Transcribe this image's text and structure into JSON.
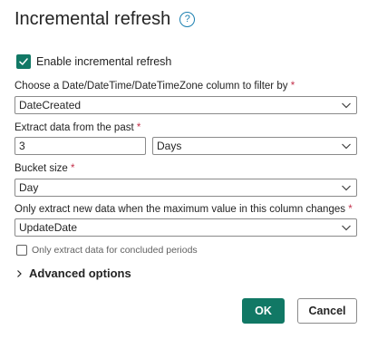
{
  "dialog": {
    "title": "Incremental refresh",
    "help_icon": "?",
    "enable": {
      "label": "Enable incremental refresh",
      "checked": true
    },
    "column": {
      "label": "Choose a Date/DateTime/DateTimeZone column to filter by",
      "required_mark": "*",
      "value": "DateCreated"
    },
    "extract": {
      "label": "Extract data from the past",
      "required_mark": "*",
      "number_value": "3",
      "unit_value": "Days"
    },
    "bucket": {
      "label": "Bucket size",
      "required_mark": "*",
      "value": "Day"
    },
    "detect": {
      "label": "Only extract new data when the maximum value in this column changes",
      "required_mark": "*",
      "value": "UpdateDate"
    },
    "concluded": {
      "label": "Only extract data for concluded periods",
      "checked": false
    },
    "advanced": {
      "label": "Advanced options"
    },
    "buttons": {
      "ok": "OK",
      "cancel": "Cancel"
    },
    "colors": {
      "accent": "#117865",
      "required": "#c4314b",
      "help": "#1a7fb0"
    },
    "icons": {
      "help": "question-circle-icon",
      "check": "checkmark-icon",
      "dropdown": "chevron-down-icon",
      "expand": "chevron-right-icon"
    }
  }
}
